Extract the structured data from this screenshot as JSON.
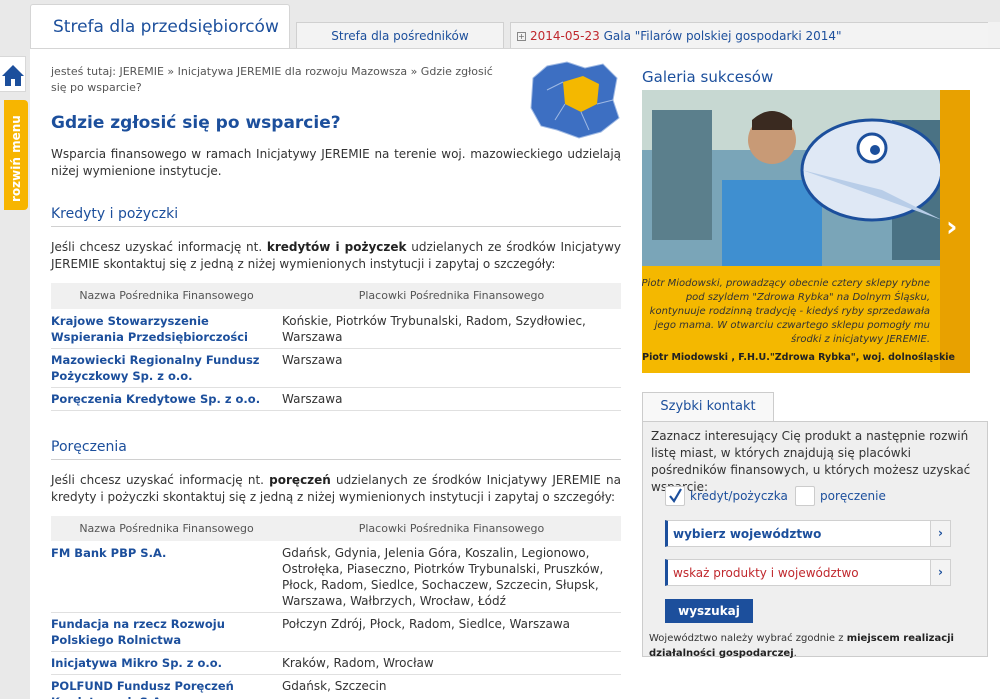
{
  "tabs": {
    "main": "Strefa dla przedsiębiorców",
    "second": "Strefa dla pośredników",
    "news_date": "2014-05-23",
    "news_title": "Gala \"Filarów polskiej gospodarki 2014\""
  },
  "side": {
    "home_icon": "home-icon",
    "menu_label": "rozwiń menu"
  },
  "breadcrumb": {
    "text": "jesteś tutaj: JEREMIE » Inicjatywa JEREMIE dla rozwoju Mazowsza » Gdzie zgłosić się po wsparcie?"
  },
  "page": {
    "title": "Gdzie zgłosić się po wsparcie?",
    "intro": "Wsparcia finansowego w ramach Inicjatywy JEREMIE na terenie woj. mazowieckiego udzielają niżej wymienione instytucje."
  },
  "table_headers": {
    "name": "Nazwa Pośrednika Finansowego",
    "locations": "Placowki Pośrednika Finansowego"
  },
  "section_loans": {
    "title": "Kredyty i pożyczki",
    "text_before": "Jeśli chcesz uzyskać informację nt. ",
    "text_bold": "kredytów i pożyczek",
    "text_after": " udzielanych ze środków Inicjatywy JEREMIE skontaktuj się z jedną z niżej wymienionych instytucji i zapytaj o szczegóły:",
    "rows": [
      {
        "name": "Krajowe Stowarzyszenie Wspierania Przedsiębiorczości",
        "locations": "Końskie, Piotrków Trybunalski, Radom, Szydłowiec, Warszawa"
      },
      {
        "name": "Mazowiecki Regionalny Fundusz Pożyczkowy Sp. z o.o.",
        "locations": "Warszawa"
      },
      {
        "name": "Poręczenia Kredytowe Sp. z o.o.",
        "locations": "Warszawa"
      }
    ]
  },
  "section_guarantees": {
    "title": "Poręczenia",
    "text_before": "Jeśli chcesz uzyskać informację nt. ",
    "text_bold": "poręczeń",
    "text_after": " udzielanych ze środków Inicjatywy JEREMIE na kredyty i pożyczki skontaktuj się z jedną z niżej wymienionych instytucji i zapytaj o szczegóły:",
    "rows": [
      {
        "name": "FM Bank PBP S.A.",
        "locations": "Gdańsk, Gdynia, Jelenia Góra, Koszalin, Legionowo, Ostrołęka, Piaseczno, Piotrków Trybunalski, Pruszków, Płock, Radom, Siedlce, Sochaczew, Szczecin, Słupsk, Warszawa, Wałbrzych, Wrocław, Łódź"
      },
      {
        "name": "Fundacja na rzecz Rozwoju Polskiego Rolnictwa",
        "locations": "Połczyn Zdrój, Płock, Radom, Siedlce, Warszawa"
      },
      {
        "name": "Inicjatywa Mikro Sp. z o.o.",
        "locations": "Kraków, Radom, Wrocław"
      },
      {
        "name": "POLFUND Fundusz Poręczeń Kredytowych S.A.",
        "locations": "Gdańsk, Szczecin"
      }
    ]
  },
  "gallery": {
    "title": "Galeria sukcesów",
    "caption": "Piotr Miodowski, prowadzący obecnie cztery sklepy rybne pod szyldem \"Zdrowa Rybka\" na Dolnym Śląsku, kontynuuje rodzinną tradycję - kiedyś ryby sprzedawała jego mama. W otwarciu czwartego sklepu pomogły mu środki z inicjatywy JEREMIE.",
    "author": "Piotr Miodowski , F.H.U.\"Zdrowa Rybka\", woj. dolnośląskie",
    "next_icon": "chevron-right-icon"
  },
  "quick_contact": {
    "tab": "Szybki kontakt",
    "text": "Zaznacz interesujący Cię produkt a następnie rozwiń listę miast, w których znajdują się placówki pośredników finansowych, u których możesz uzyskać wsparcie:",
    "option1": "kredyt/pożyczka",
    "option1_checked": true,
    "option2": "poręczenie",
    "option2_checked": false,
    "select1": "wybierz województwo",
    "select2": "wskaż produkty i województwo",
    "button": "wyszukaj",
    "note_before": "Województwo należy wybrać zgodnie z ",
    "note_bold": "miejscem realizacji działalności gospodarczej",
    "note_after": "."
  },
  "colors": {
    "brand_blue": "#1c4f9c",
    "accent_yellow": "#f4b800",
    "date_red": "#c0282d"
  }
}
